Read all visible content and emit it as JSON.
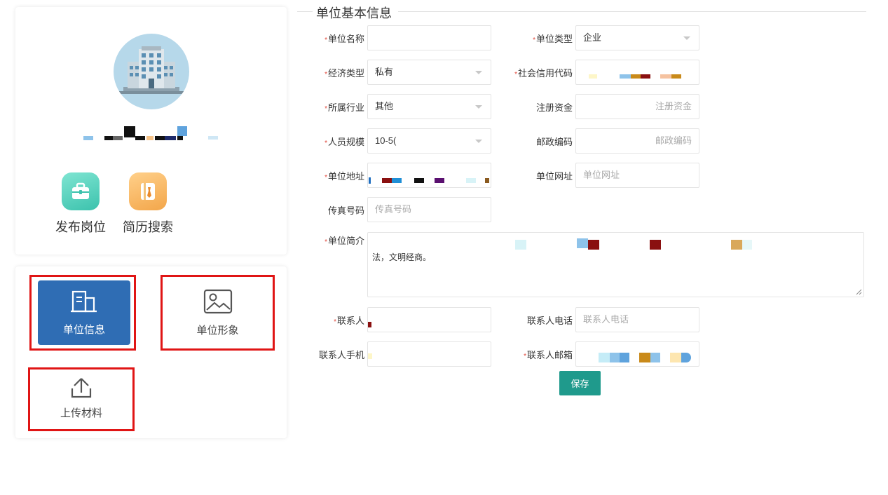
{
  "profile": {
    "avatar_icon": "office-building-icon",
    "company_name": "",
    "quick_actions": [
      {
        "label": "发布岗位",
        "icon": "briefcase-icon",
        "color": "#3cc2ad"
      },
      {
        "label": "简历搜索",
        "icon": "resume-book-icon",
        "color": "#f3a64a"
      }
    ]
  },
  "menu": {
    "items": [
      {
        "label": "单位信息",
        "icon": "building-icon",
        "active": true
      },
      {
        "label": "单位形象",
        "icon": "image-icon",
        "active": false
      },
      {
        "label": "上传材料",
        "icon": "upload-icon",
        "active": false
      }
    ],
    "highlight_color": "#e01515",
    "active_color": "#2f6db4"
  },
  "form": {
    "section_title": "单位基本信息",
    "fields": {
      "unit_name": {
        "label": "单位名称",
        "required": true,
        "value": ""
      },
      "unit_type": {
        "label": "单位类型",
        "required": true,
        "value": "企业"
      },
      "economic_type": {
        "label": "经济类型",
        "required": true,
        "value": "私有"
      },
      "credit_code": {
        "label": "社会信用代码",
        "required": true,
        "value": ""
      },
      "industry": {
        "label": "所属行业",
        "required": true,
        "value": "其他"
      },
      "registered_capital": {
        "label": "注册资金",
        "required": false,
        "placeholder": "注册资金"
      },
      "staff_size": {
        "label": "人员规模",
        "required": true,
        "value": "10-5("
      },
      "postal_code": {
        "label": "邮政编码",
        "required": false,
        "placeholder": "邮政编码"
      },
      "address": {
        "label": "单位地址",
        "required": true,
        "value": ""
      },
      "website": {
        "label": "单位网址",
        "required": false,
        "placeholder": "单位网址"
      },
      "fax": {
        "label": "传真号码",
        "required": false,
        "placeholder": "传真号码"
      },
      "intro": {
        "label": "单位简介",
        "required": true,
        "value": "法，文明经商。"
      },
      "contact": {
        "label": "联系人",
        "required": true,
        "value": ""
      },
      "contact_phone": {
        "label": "联系人电话",
        "required": false,
        "placeholder": "联系人电话"
      },
      "contact_mobile": {
        "label": "联系人手机",
        "required": false,
        "value": ""
      },
      "contact_email": {
        "label": "联系人邮箱",
        "required": true,
        "value": ""
      }
    },
    "save_label": "保存",
    "save_color": "#1f9a8c",
    "required_mark": "*"
  }
}
